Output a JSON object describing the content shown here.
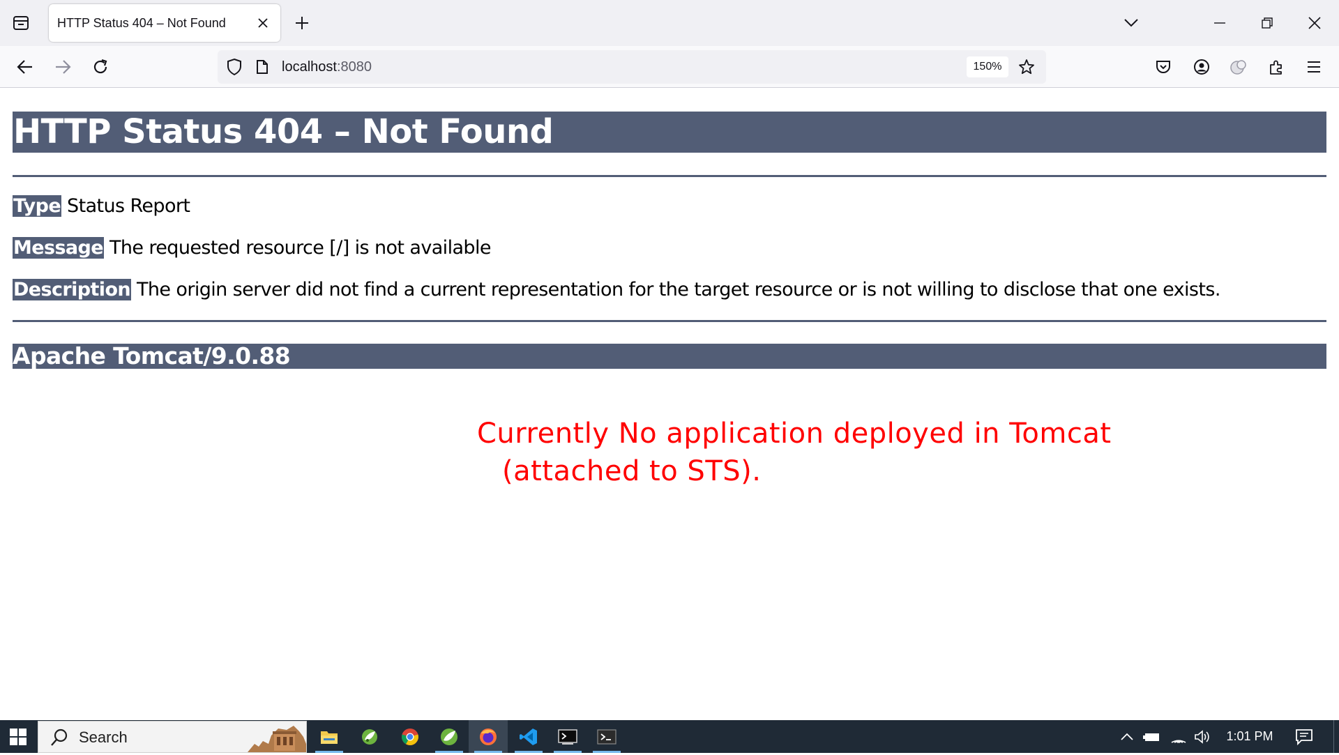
{
  "browser": {
    "tab": {
      "title": "HTTP Status 404 – Not Found"
    },
    "url": {
      "host": "localhost",
      "port": ":8080"
    },
    "zoom": "150%"
  },
  "page": {
    "heading": "HTTP Status 404 – Not Found",
    "rows": [
      {
        "label": "Type",
        "value": " Status Report"
      },
      {
        "label": "Message",
        "value": " The requested resource [/] is not available"
      },
      {
        "label": "Description",
        "value": " The origin server did not find a current representation for the target resource or is not willing to disclose that one exists."
      }
    ],
    "server_footer": "Apache Tomcat/9.0.88",
    "annotation": {
      "line1": "Currently No application deployed in Tomcat",
      "line2": "(attached to STS).",
      "color": "#ff0000"
    },
    "accent_color": "#525d76"
  },
  "taskbar": {
    "search_placeholder": "Search",
    "apps": [
      "file-explorer-icon",
      "spring-tool-suite-icon",
      "chrome-icon",
      "spring-icon",
      "firefox-icon",
      "vscode-icon",
      "terminal-icon",
      "powershell-icon"
    ],
    "active_app": "firefox-icon",
    "clock": "1:01 PM"
  }
}
